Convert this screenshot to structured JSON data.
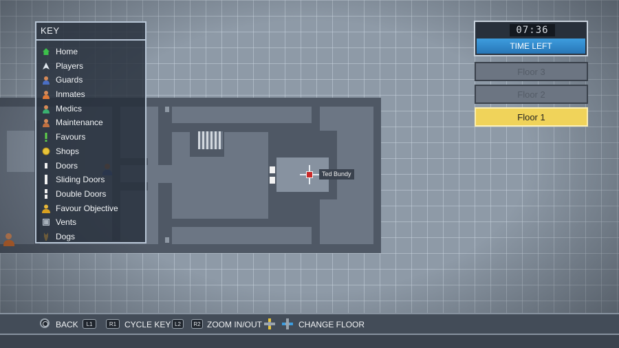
{
  "key": {
    "title": "KEY",
    "items": [
      {
        "label": "Home",
        "icon": "home-icon",
        "color": "#3cc04a"
      },
      {
        "label": "Players",
        "icon": "player-arrow-icon",
        "color": "#dfe6ee"
      },
      {
        "label": "Guards",
        "icon": "guard-icon",
        "color": "#4a6fc4"
      },
      {
        "label": "Inmates",
        "icon": "inmate-icon",
        "color": "#e07a38"
      },
      {
        "label": "Medics",
        "icon": "medic-icon",
        "color": "#3ab070"
      },
      {
        "label": "Maintenance",
        "icon": "maintenance-icon",
        "color": "#c07040"
      },
      {
        "label": "Favours",
        "icon": "exclamation-icon",
        "color": "#5fd24a"
      },
      {
        "label": "Shops",
        "icon": "coin-icon",
        "color": "#e8c43a"
      },
      {
        "label": "Doors",
        "icon": "door-icon",
        "color": "#f2f2f2"
      },
      {
        "label": "Sliding Doors",
        "icon": "sliding-door-icon",
        "color": "#f2f2f2"
      },
      {
        "label": "Double Doors",
        "icon": "double-door-icon",
        "color": "#f2f2f2"
      },
      {
        "label": "Favour Objective",
        "icon": "favour-objective-icon",
        "color": "#e8b83a"
      },
      {
        "label": "Vents",
        "icon": "vent-icon",
        "color": "#b8c2cc"
      },
      {
        "label": "Dogs",
        "icon": "dog-icon",
        "color": "#6b5a3a"
      }
    ]
  },
  "timer": {
    "value": "07:36",
    "label": "TIME LEFT"
  },
  "floors": [
    {
      "label": "Floor 3",
      "active": false
    },
    {
      "label": "Floor 2",
      "active": false
    },
    {
      "label": "Floor 1",
      "active": true
    }
  ],
  "map": {
    "player_name": "Ted Bundy"
  },
  "controls": {
    "back_label": "BACK",
    "l1": "L1",
    "r1": "R1",
    "cycle_key_label": "CYCLE KEY",
    "l2": "L2",
    "r2": "R2",
    "zoom_label": "ZOOM IN/OUT",
    "change_floor_label": "CHANGE FLOOR"
  }
}
